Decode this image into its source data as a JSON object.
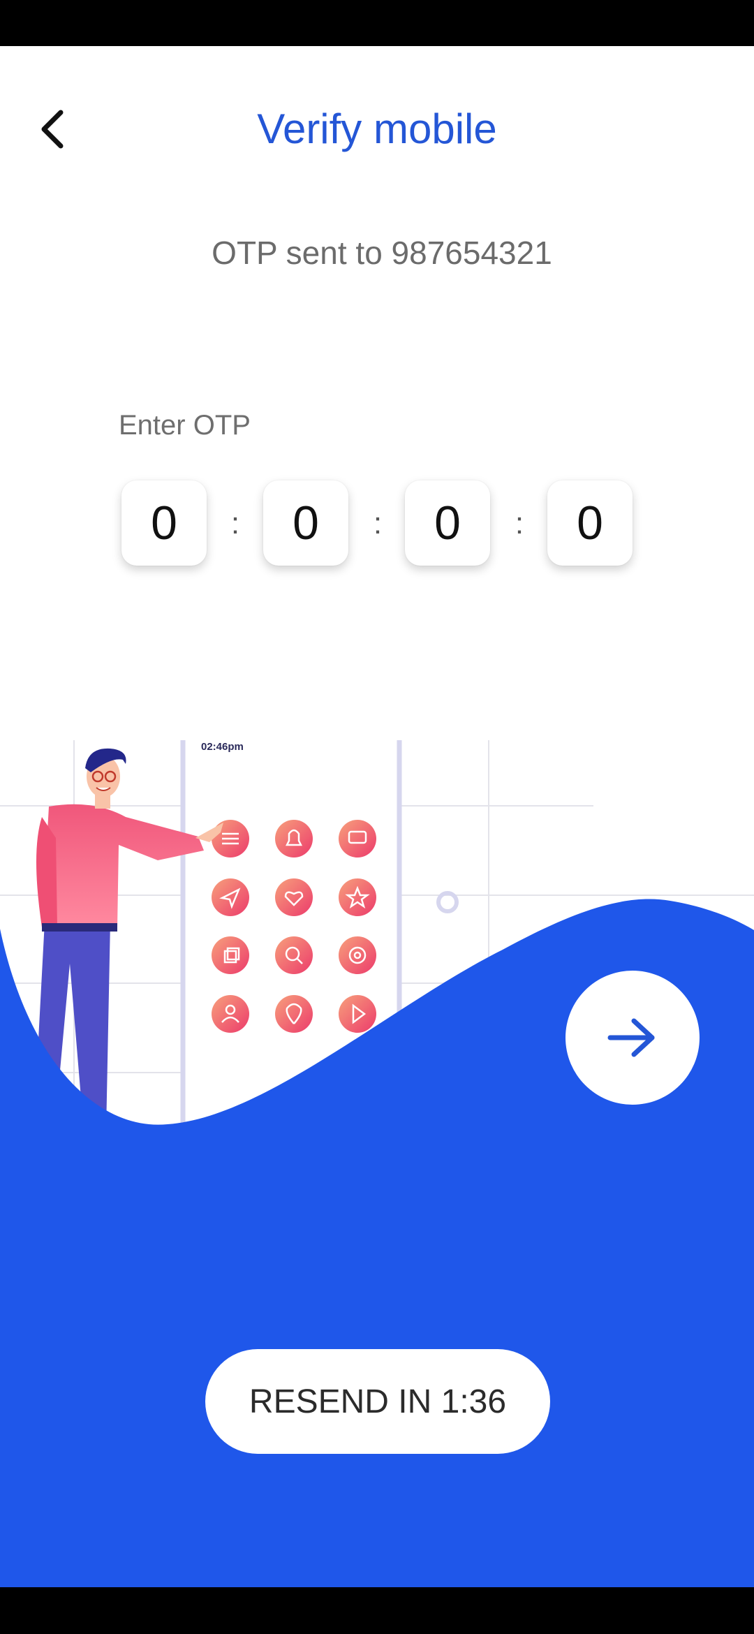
{
  "header": {
    "title": "Verify mobile",
    "back_icon": "chevron-left-icon"
  },
  "message": {
    "otp_sent": "OTP sent to 987654321"
  },
  "otp": {
    "label": "Enter OTP",
    "digits": [
      "0",
      "0",
      "0",
      "0"
    ],
    "separator": ":"
  },
  "illustration": {
    "phone_time": "02:46pm",
    "icons": [
      "menu-icon",
      "bell-icon",
      "chat-icon",
      "send-icon",
      "heart-icon",
      "star-icon",
      "copy-icon",
      "search-icon",
      "gear-icon",
      "user-icon",
      "location-pin-icon",
      "play-icon"
    ]
  },
  "actions": {
    "next_icon": "arrow-right-icon",
    "resend_label": "RESEND IN 1:36"
  },
  "colors": {
    "accent": "#2456d6",
    "wave": "#1f57ea",
    "icon_gradient_start": "#f5917a",
    "icon_gradient_end": "#ee3f6d"
  }
}
